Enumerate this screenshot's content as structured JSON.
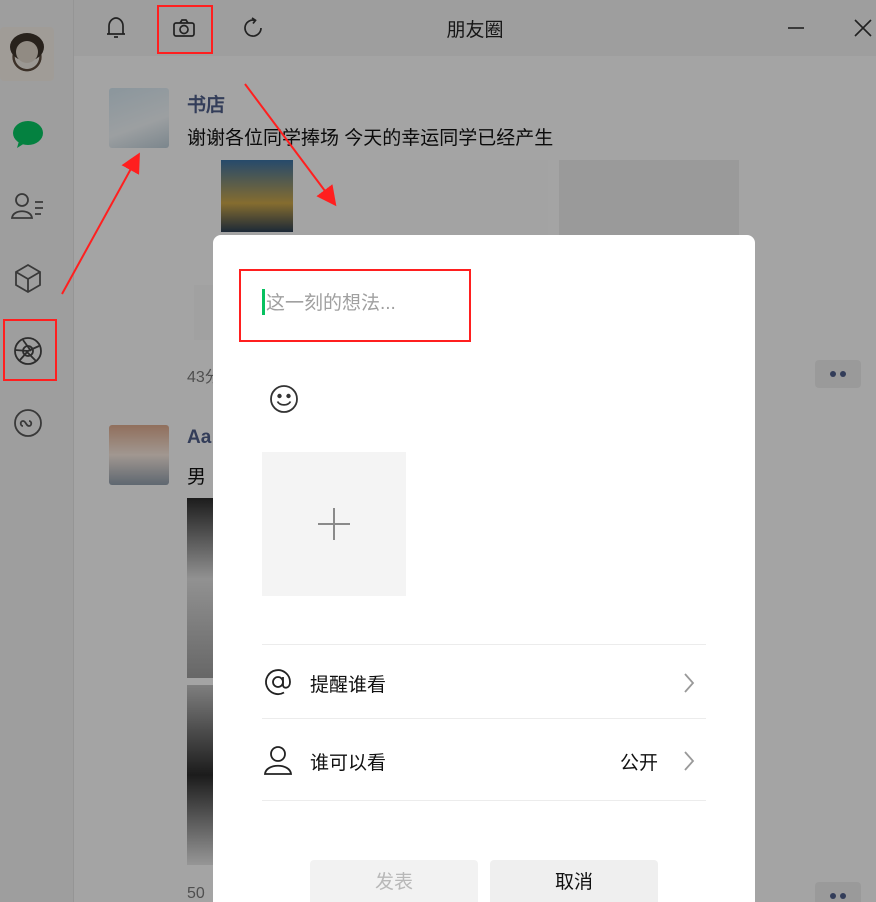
{
  "window": {
    "title": "朋友圈"
  },
  "posts": [
    {
      "name": "书店",
      "text": "谢谢各位同学捧场 今天的幸运同学已经产生",
      "time": "43分"
    },
    {
      "name": "Aa",
      "text": "男",
      "time": "50"
    }
  ],
  "composer": {
    "placeholder": "这一刻的想法...",
    "mention_label": "提醒谁看",
    "visibility_label": "谁可以看",
    "visibility_value": "公开",
    "post_button": "发表",
    "cancel_button": "取消"
  },
  "icons": {
    "sidebar": [
      "chat-icon",
      "contacts-icon",
      "favorites-icon",
      "moments-icon",
      "miniprogram-icon"
    ],
    "toolbar": [
      "bell-icon",
      "camera-icon",
      "refresh-icon",
      "minimize-icon",
      "close-icon"
    ],
    "composer": [
      "emoji-icon",
      "add-photo-icon",
      "at-icon",
      "person-icon",
      "chevron-right-icon"
    ]
  },
  "colors": {
    "accent_green": "#07c160",
    "name_blue": "#4d5b85",
    "annotation_red": "#ff1f1f"
  }
}
